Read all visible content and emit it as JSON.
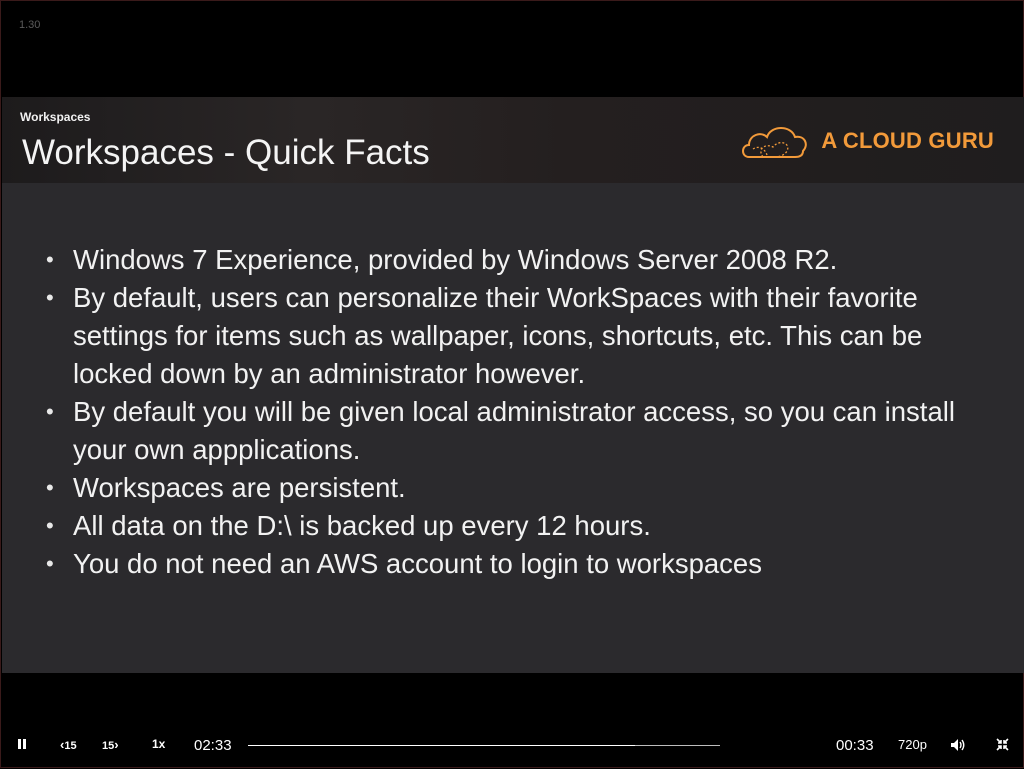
{
  "player": {
    "version": "1.30",
    "slide": {
      "section": "Workspaces",
      "title": "Workspaces - Quick Facts",
      "brand": "A CLOUD GURU",
      "bullets": [
        "Windows 7 Experience, provided by Windows Server 2008 R2.",
        "By default, users can personalize their WorkSpaces with their favorite settings for items such as wallpaper, icons, shortcuts, etc. This can be locked down by an administrator however.",
        "By default you will be given local administrator access, so you can install your own appplications.",
        "Workspaces are persistent.",
        "All data on the D:\\ is backed up every 12 hours.",
        "You do not need an AWS account to login to workspaces"
      ]
    },
    "controls": {
      "pause_icon": "pause-icon",
      "rewind_label": "15",
      "forward_label": "15",
      "speed": "1x",
      "elapsed": "02:33",
      "progress_fraction": 0.82,
      "remaining": "00:33",
      "quality": "720p",
      "volume_icon": "volume-icon",
      "exit_fullscreen_icon": "exit-fullscreen-icon"
    },
    "colors": {
      "brand": "#f29a3a",
      "slide_background": "#2b2a2d",
      "player_background": "#000000"
    }
  }
}
